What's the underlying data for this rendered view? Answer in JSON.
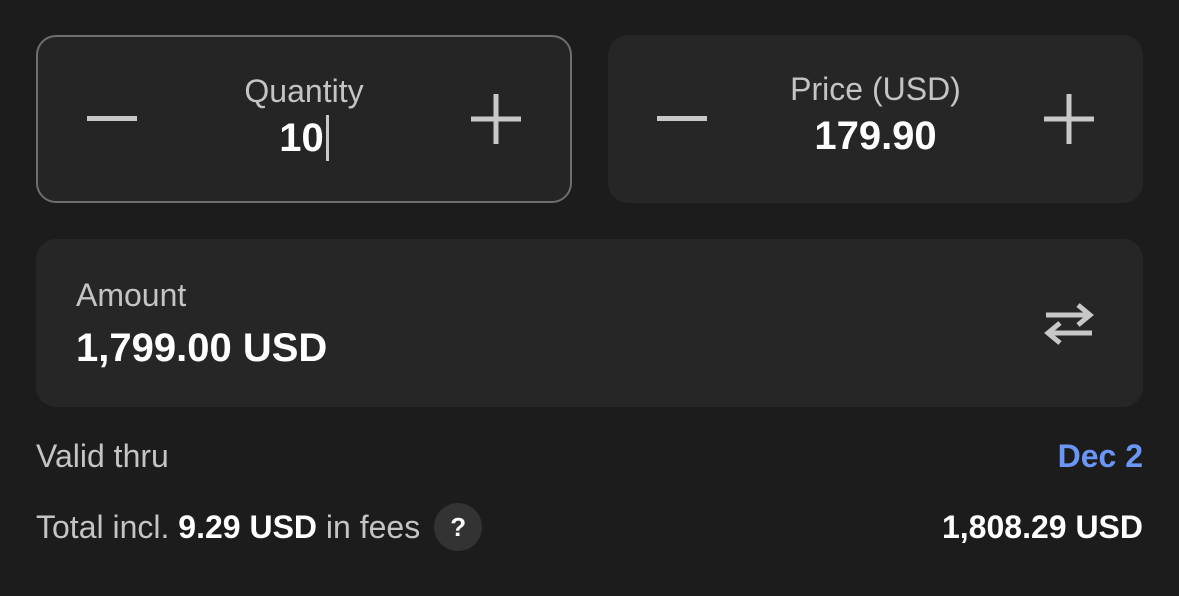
{
  "quantity": {
    "label": "Quantity",
    "value": "10",
    "decrement_icon": "minus-icon",
    "increment_icon": "plus-icon"
  },
  "price": {
    "label": "Price (USD)",
    "value": "179.90",
    "decrement_icon": "minus-icon",
    "increment_icon": "plus-icon"
  },
  "amount": {
    "label": "Amount",
    "value": "1,799.00 USD",
    "swap_icon": "swap-arrows-icon"
  },
  "valid_thru": {
    "label": "Valid thru",
    "value": "Dec 2"
  },
  "total": {
    "prefix": "Total incl.",
    "fee": "9.29 USD",
    "suffix": "in fees",
    "help_label": "?",
    "value": "1,808.29 USD"
  },
  "colors": {
    "background": "#1c1c1c",
    "card": "#262626",
    "focused_border": "#6e6e6e",
    "accent_link": "#6a96f5",
    "muted_text": "#c4c4c4"
  }
}
